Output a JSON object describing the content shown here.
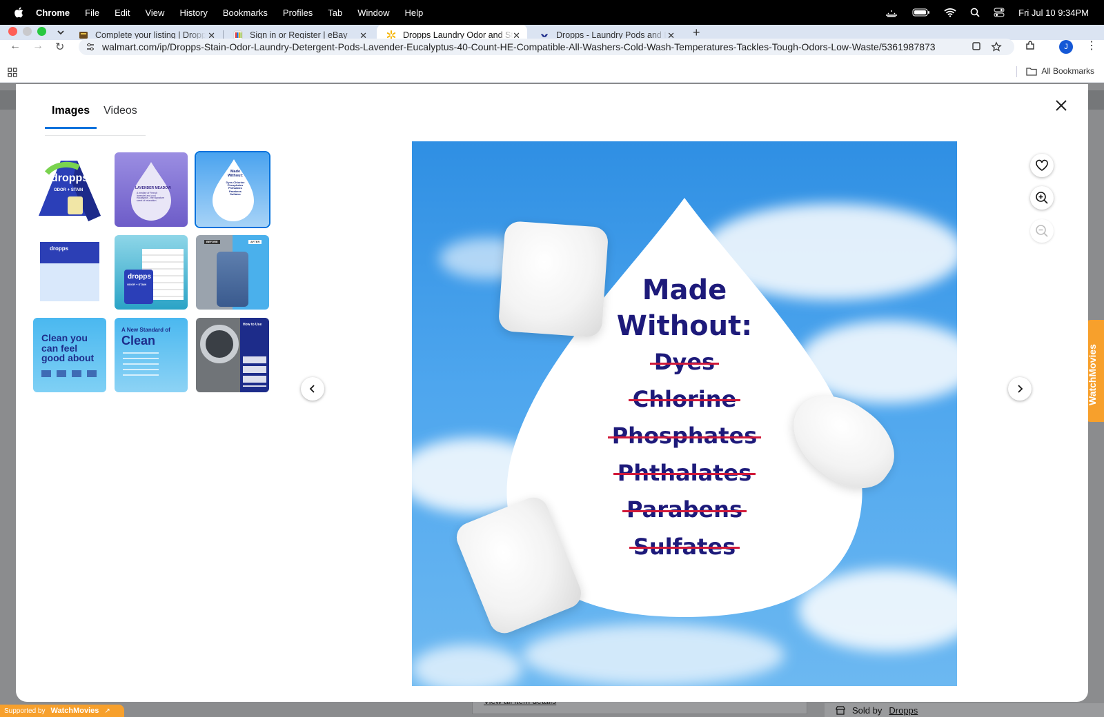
{
  "menubar": {
    "app": "Chrome",
    "items": [
      "File",
      "Edit",
      "View",
      "History",
      "Bookmarks",
      "Profiles",
      "Tab",
      "Window",
      "Help"
    ],
    "clock": "Fri Jul 10  9:34PM"
  },
  "tabs": [
    {
      "title": "Complete your listing | Dropps",
      "favicon": "ebay-listing-icon"
    },
    {
      "title": "Sign in or Register | eBay",
      "favicon": "ebay-icon"
    },
    {
      "title": "Dropps Laundry Odor and Stain",
      "favicon": "walmart-spark-icon"
    },
    {
      "title": "Dropps - Laundry Pods and Dish",
      "favicon": "dropps-icon"
    }
  ],
  "address_bar": {
    "url": "walmart.com/ip/Dropps-Stain-Odor-Laundry-Detergent-Pods-Lavender-Eucalyptus-40-Count-HE-Compatible-All-Washers-Cold-Wash-Temperatures-Tackles-Tough-Odors-Low-Waste/5361987873"
  },
  "profile_initial": "J",
  "bookmarks": {
    "all_label": "All Bookmarks"
  },
  "modal": {
    "tabs": [
      {
        "label": "Images"
      },
      {
        "label": "Videos"
      }
    ],
    "thumbnails": [
      {
        "caption": "dropps",
        "sub": "ODOR + STAIN"
      },
      {
        "caption": "LAVENDER MEADOW",
        "sub": "A medley of French lavender and cool eucalyptus - the signature scent of relaxation."
      },
      {
        "caption": "Made Without:",
        "sub": "Dyes Chlorine Phosphates Phthalates Parabens Sulfates"
      },
      {
        "caption": "dropps",
        "sub": ""
      },
      {
        "caption": "dropps",
        "sub": "ODOR + STAIN"
      },
      {
        "caption": "BEFORE",
        "sub": "AFTER"
      },
      {
        "caption": "Clean you can feel good about",
        "sub": ""
      },
      {
        "caption": "A New Standard of",
        "sub": "Clean"
      },
      {
        "caption": "How to Use",
        "sub": ""
      }
    ],
    "main_image": {
      "heading_line1": "Made",
      "heading_line2": "Without:",
      "items": [
        "Dyes",
        "Chlorine",
        "Phosphates",
        "Phthalates",
        "Parabens",
        "Sulfates"
      ]
    }
  },
  "page_behind": {
    "view_all": "View all item details",
    "sold_by_label": "Sold by",
    "sold_by_value": "Dropps"
  },
  "watchmovies": {
    "supported_by": "Supported by",
    "brand": "WatchMovies"
  }
}
